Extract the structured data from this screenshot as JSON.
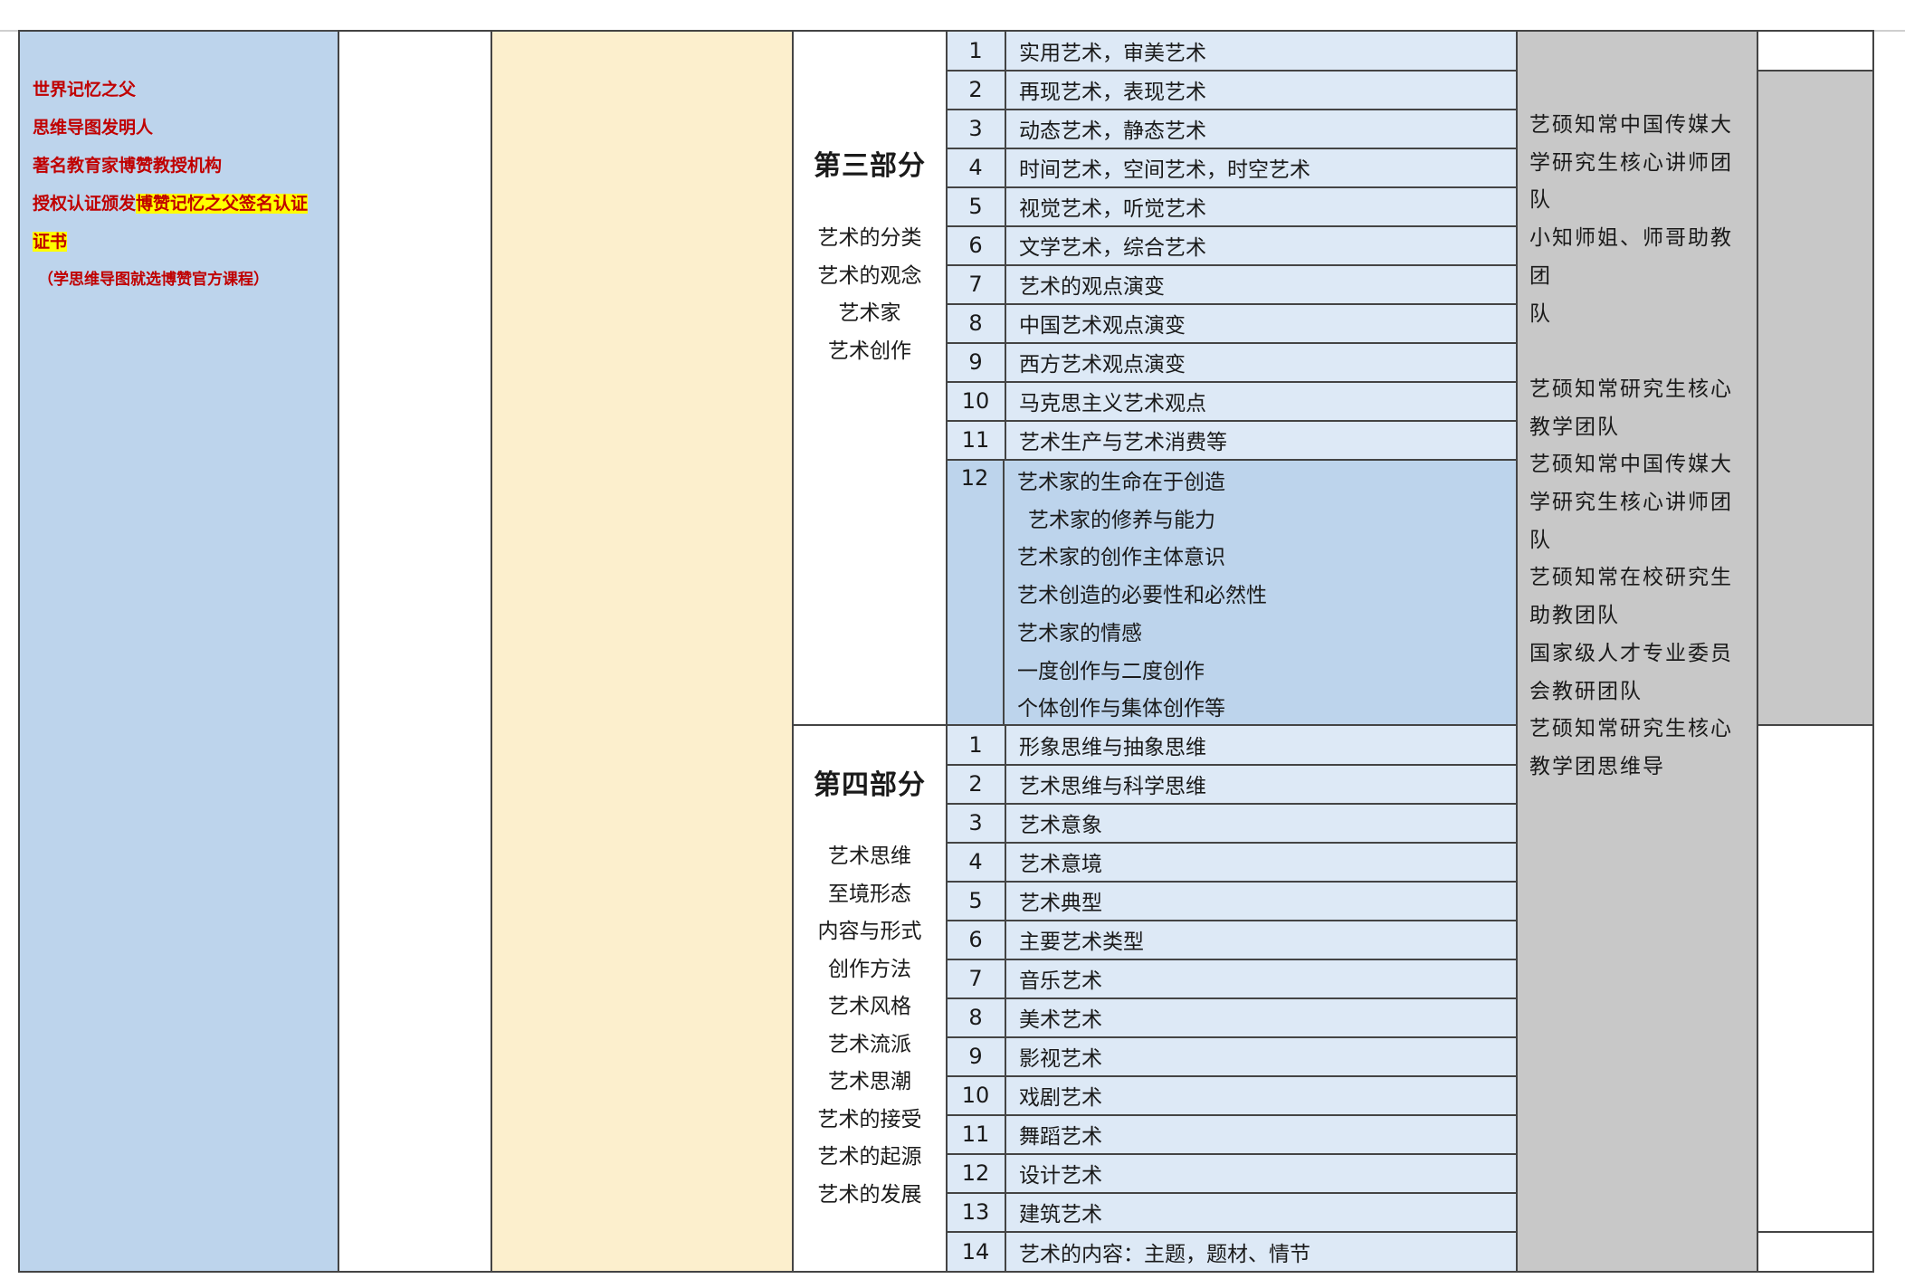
{
  "left_notes": {
    "line1": "世界记忆之父",
    "line2": "思维导图发明人",
    "line3": "著名教育家博赞教授机构",
    "line4_plain": "授权认证颁发",
    "line4_highlight": "博赞记忆之父签名认证",
    "line5_highlight": "证书",
    "note": "（学思维导图就选博赞官方课程）"
  },
  "part3": {
    "title": "第三部分",
    "topics": [
      "艺术的分类",
      "艺术的观念",
      "艺术家",
      "艺术创作"
    ],
    "rows": [
      {
        "num": "1",
        "text": "实用艺术，审美艺术"
      },
      {
        "num": "2",
        "text": "再现艺术，表现艺术"
      },
      {
        "num": "3",
        "text": "动态艺术，静态艺术"
      },
      {
        "num": "4",
        "text": "时间艺术，空间艺术，时空艺术"
      },
      {
        "num": "5",
        "text": "视觉艺术，听觉艺术"
      },
      {
        "num": "6",
        "text": "文学艺术，综合艺术"
      },
      {
        "num": "7",
        "text": "艺术的观点演变"
      },
      {
        "num": "8",
        "text": "中国艺术观点演变"
      },
      {
        "num": "9",
        "text": "西方艺术观点演变"
      },
      {
        "num": "10",
        "text": "马克思主义艺术观点"
      },
      {
        "num": "11",
        "text": "艺术生产与艺术消费等"
      }
    ],
    "row12": {
      "num": "12",
      "lines": [
        "艺术家的生命在于创造",
        "艺术家的修养与能力",
        "艺术家的创作主体意识",
        "艺术创造的必要性和必然性",
        "艺术家的情感",
        "一度创作与二度创作",
        "个体创作与集体创作等"
      ]
    }
  },
  "part4": {
    "title": "第四部分",
    "topics": [
      "艺术思维",
      "至境形态",
      "内容与形式",
      "创作方法",
      "艺术风格",
      "艺术流派",
      "艺术思潮",
      "艺术的接受",
      "艺术的起源",
      "艺术的发展"
    ],
    "rows": [
      {
        "num": "1",
        "text": "形象思维与抽象思维"
      },
      {
        "num": "2",
        "text": "艺术思维与科学思维"
      },
      {
        "num": "3",
        "text": "艺术意象"
      },
      {
        "num": "4",
        "text": "艺术意境"
      },
      {
        "num": "5",
        "text": "艺术典型"
      },
      {
        "num": "6",
        "text": "主要艺术类型"
      },
      {
        "num": "7",
        "text": "音乐艺术"
      },
      {
        "num": "8",
        "text": "美术艺术"
      },
      {
        "num": "9",
        "text": "影视艺术"
      },
      {
        "num": "10",
        "text": "戏剧艺术"
      },
      {
        "num": "11",
        "text": "舞蹈艺术"
      },
      {
        "num": "12",
        "text": "设计艺术"
      },
      {
        "num": "13",
        "text": "建筑艺术"
      },
      {
        "num": "14",
        "text": "艺术的内容：主题，题材、情节"
      }
    ]
  },
  "team": {
    "block1": [
      "艺硕知常中国传媒大",
      "学研究生核心讲师团",
      "队",
      "小知师姐、师哥助教团",
      "队"
    ],
    "block2": [
      "艺硕知常研究生核心",
      "教学团队",
      "艺硕知常中国传媒大",
      "学研究生核心讲师团",
      "队",
      "艺硕知常在校研究生",
      "助教团队",
      "国家级人才专业委员",
      "会教研团队",
      "艺硕知常研究生核心",
      "教学团思维导"
    ]
  }
}
